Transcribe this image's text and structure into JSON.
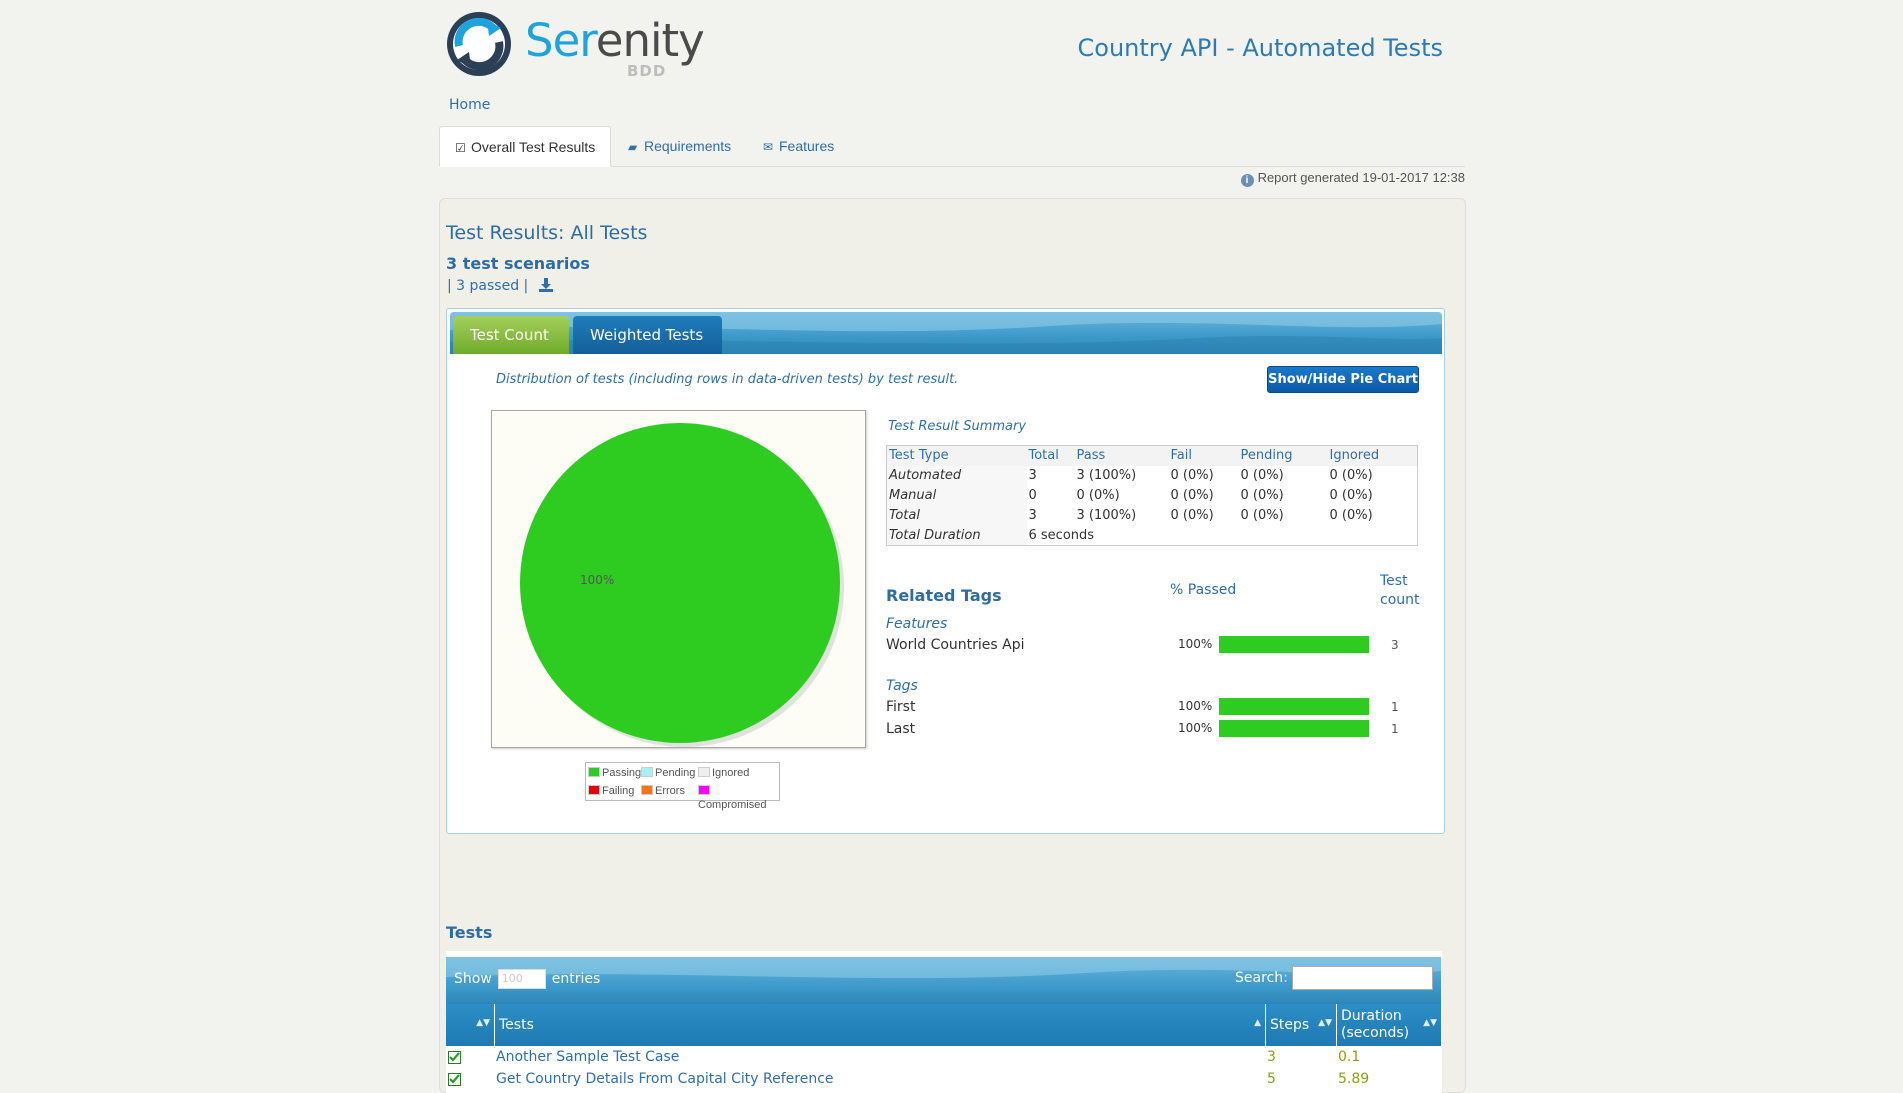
{
  "header": {
    "logo_word_main": "Ser",
    "logo_word_rest": "enity",
    "logo_sub": "BDD",
    "project_title": "Country API - Automated Tests"
  },
  "breadcrumb": {
    "home": "Home"
  },
  "nav_tabs": [
    {
      "label": "Overall Test Results",
      "icon": "check-square-icon",
      "active": true
    },
    {
      "label": "Requirements",
      "icon": "book-icon",
      "active": false
    },
    {
      "label": "Features",
      "icon": "comments-icon",
      "active": false
    }
  ],
  "report_generated": "Report generated 19-01-2017 12:38",
  "results": {
    "title": "Test Results: All Tests",
    "scenarios": "3 test scenarios",
    "passed": "3 passed"
  },
  "chart_tabs": {
    "test_count": "Test Count",
    "weighted": "Weighted Tests"
  },
  "distribution_text": "Distribution of tests (including rows in data-driven tests) by test result.",
  "toggle_button": "Show/Hide Pie Chart",
  "chart_data": {
    "type": "pie",
    "slices": [
      {
        "label": "Passing",
        "value": 100,
        "color": "#2ecc21"
      },
      {
        "label": "Pending",
        "value": 0,
        "color": "#a8f0f8"
      },
      {
        "label": "Ignored",
        "value": 0,
        "color": "#eeeeee"
      },
      {
        "label": "Failing",
        "value": 0,
        "color": "#e0000e"
      },
      {
        "label": "Errors",
        "value": 0,
        "color": "#f5741a"
      },
      {
        "label": "Compromised",
        "value": 0,
        "color": "#ff00ff"
      }
    ],
    "slice_label": "100%"
  },
  "summary": {
    "title": "Test Result Summary",
    "headers": [
      "Test Type",
      "Total",
      "Pass",
      "Fail",
      "Pending",
      "Ignored"
    ],
    "rows": [
      [
        "Automated",
        "3",
        "3 (100%)",
        "0 (0%)",
        "0 (0%)",
        "0 (0%)"
      ],
      [
        "Manual",
        "0",
        "0 (0%)",
        "0 (0%)",
        "0 (0%)",
        "0 (0%)"
      ],
      [
        "Total",
        "3",
        "3 (100%)",
        "0 (0%)",
        "0 (0%)",
        "0 (0%)"
      ]
    ],
    "duration_label": "Total Duration",
    "duration_value": "6 seconds"
  },
  "related_tags": {
    "title": "Related Tags",
    "pct_header": "% Passed",
    "count_header_1": "Test",
    "count_header_2": "count",
    "groups": [
      {
        "name": "Features",
        "items": [
          {
            "name": "World Countries Api",
            "pct": "100%",
            "fraction": 1.0,
            "count": "3"
          }
        ]
      },
      {
        "name": "Tags",
        "items": [
          {
            "name": "First",
            "pct": "100%",
            "fraction": 1.0,
            "count": "1"
          },
          {
            "name": "Last",
            "pct": "100%",
            "fraction": 1.0,
            "count": "1"
          }
        ]
      }
    ]
  },
  "tests": {
    "title": "Tests",
    "show_label": "Show",
    "show_value": "100",
    "entries_label": "entries",
    "search_label": "Search:",
    "columns": [
      "Tests",
      "Steps",
      "Duration (seconds)"
    ],
    "duration_line1": "Duration",
    "duration_line2": "(seconds)",
    "rows": [
      {
        "name": "Another Sample Test Case",
        "steps": "3",
        "duration": "0.1"
      },
      {
        "name": "Get Country Details From Capital City Reference",
        "steps": "5",
        "duration": "5.89"
      }
    ]
  }
}
